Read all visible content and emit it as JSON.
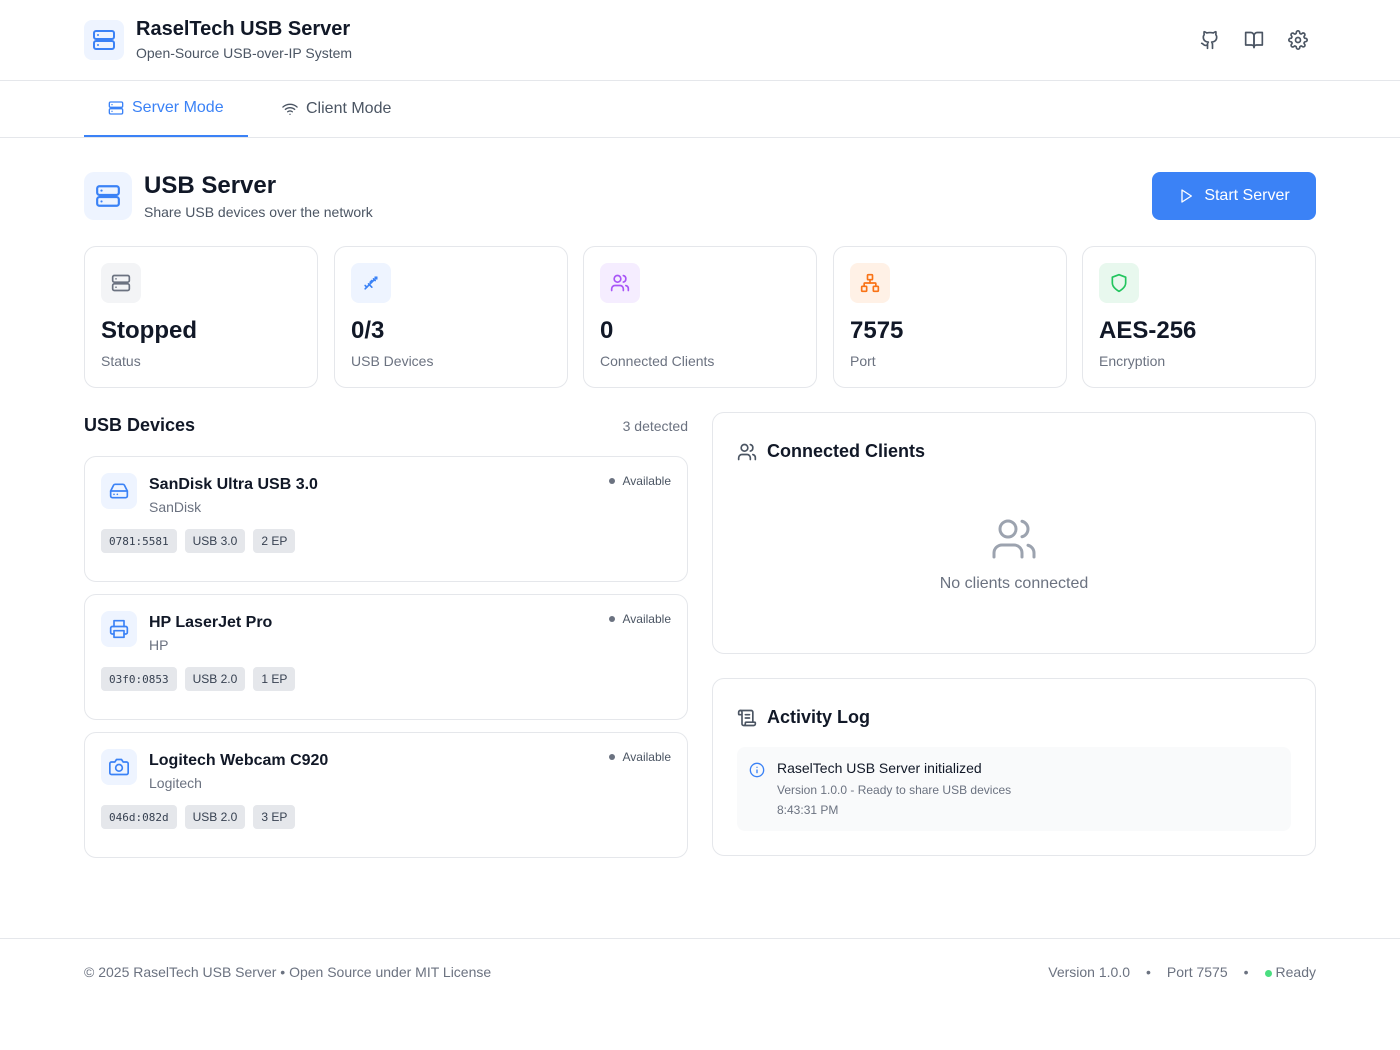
{
  "app": {
    "title": "RaselTech USB Server",
    "subtitle": "Open-Source USB-over-IP System",
    "header_icons": [
      "github-icon",
      "book-open-icon",
      "gear-icon"
    ]
  },
  "tabs": [
    {
      "label": "Server Mode",
      "icon": "server-icon",
      "active": true
    },
    {
      "label": "Client Mode",
      "icon": "wifi-icon",
      "active": false
    }
  ],
  "page": {
    "title": "USB Server",
    "subtitle": "Share USB devices over the network",
    "start_button": "Start Server"
  },
  "stats": [
    {
      "value": "Stopped",
      "label": "Status",
      "icon": "server-icon",
      "color": "#6b7280"
    },
    {
      "value": "0/3",
      "label": "USB Devices",
      "icon": "usb-icon",
      "color": "#3b82f6"
    },
    {
      "value": "0",
      "label": "Connected Clients",
      "icon": "users-icon",
      "color": "#a855f7"
    },
    {
      "value": "7575",
      "label": "Port",
      "icon": "network-icon",
      "color": "#f97316"
    },
    {
      "value": "AES-256",
      "label": "Encryption",
      "icon": "shield-icon",
      "color": "#22c55e"
    }
  ],
  "devices_section": {
    "title": "USB Devices",
    "count": "3 detected"
  },
  "devices": [
    {
      "name": "SanDisk Ultra USB 3.0",
      "vendor": "SanDisk",
      "status": "Available",
      "icon": "hard-drive-icon",
      "tags": [
        "0781:5581",
        "USB 3.0",
        "2 EP"
      ]
    },
    {
      "name": "HP LaserJet Pro",
      "vendor": "HP",
      "status": "Available",
      "icon": "printer-icon",
      "tags": [
        "03f0:0853",
        "USB 2.0",
        "1 EP"
      ]
    },
    {
      "name": "Logitech Webcam C920",
      "vendor": "Logitech",
      "status": "Available",
      "icon": "camera-icon",
      "tags": [
        "046d:082d",
        "USB 2.0",
        "3 EP"
      ]
    }
  ],
  "clients_panel": {
    "title": "Connected Clients",
    "empty": "No clients connected"
  },
  "activity_panel": {
    "title": "Activity Log",
    "entries": [
      {
        "title": "RaselTech USB Server initialized",
        "detail": "Version 1.0.0 - Ready to share USB devices",
        "time": "8:43:31 PM",
        "icon": "info-icon"
      }
    ]
  },
  "footer": {
    "left": "© 2025 RaselTech USB Server • Open Source under MIT License",
    "version": "Version 1.0.0",
    "port": "Port 7575",
    "status": "Ready",
    "separator": "•"
  },
  "colors": {
    "accent": "#3b82f6",
    "ready": "#4ade80"
  }
}
